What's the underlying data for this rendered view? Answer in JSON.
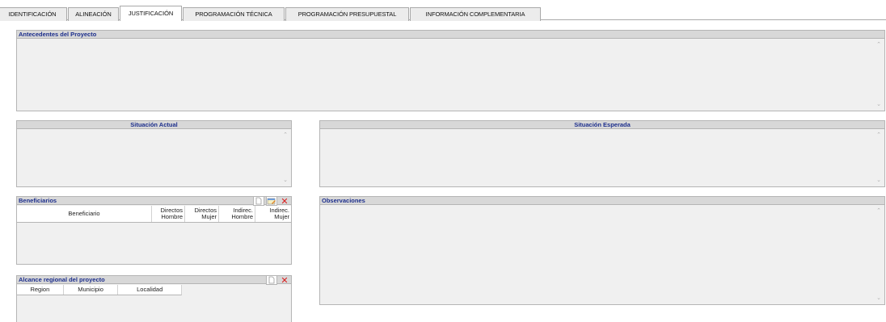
{
  "tabs": [
    {
      "label": "IDENTIFICACIÓN",
      "active": false
    },
    {
      "label": "ALINEACIÓN",
      "active": false
    },
    {
      "label": "JUSTIFICACIÓN",
      "active": true
    },
    {
      "label": "PROGRAMACIÓN TÉCNICA",
      "active": false
    },
    {
      "label": "PROGRAMACIÓN PRESUPUESTAL",
      "active": false
    },
    {
      "label": "INFORMACIÓN COMPLEMENTARIA",
      "active": false
    }
  ],
  "antecedentes": {
    "title": "Antecedentes del Proyecto",
    "value": ""
  },
  "situacion_actual": {
    "title": "Situación Actual",
    "value": ""
  },
  "situacion_esperada": {
    "title": "Situación Esperada",
    "value": ""
  },
  "beneficiarios": {
    "title": "Beneficiarios",
    "columns": [
      "Beneficiario",
      "Directos\nHombre",
      "Directos\nMujer",
      "Indirec.\nHombre",
      "Indirec.\nMujer"
    ],
    "rows": []
  },
  "alcance": {
    "title": "Alcance regional del proyecto",
    "columns": [
      "Region",
      "Municipio",
      "Localidad"
    ],
    "rows": []
  },
  "observaciones": {
    "title": "Observaciones",
    "value": ""
  },
  "icons": {
    "new": "new-document-icon",
    "edit": "edit-record-icon",
    "delete": "delete-x-icon",
    "scroll_up": "scroll-up-arrow-icon",
    "scroll_down": "scroll-down-arrow-icon"
  },
  "colors": {
    "header_text": "#1c2e8c",
    "delete_red": "#d81e1e",
    "panel_bg": "#f0f0f0"
  }
}
